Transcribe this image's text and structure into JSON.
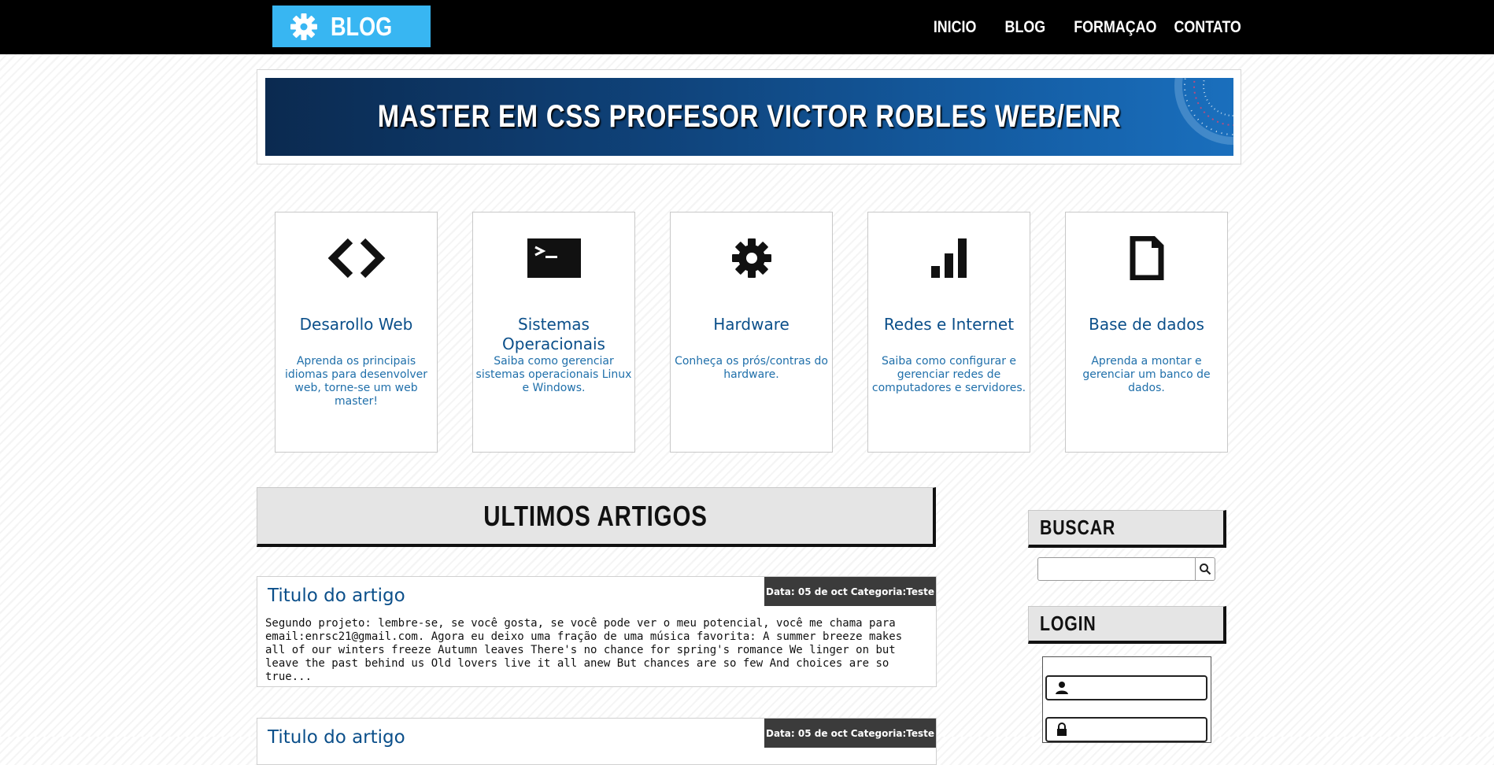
{
  "header": {
    "logo_text": "BLOG",
    "nav": [
      "INICIO",
      "BLOG",
      "FORMAÇAO",
      "CONTATO"
    ]
  },
  "banner": {
    "title": "MASTER EM CSS PROFESOR VICTOR ROBLES WEB/ENR"
  },
  "cards": [
    {
      "icon": "code-icon",
      "title": "Desarollo Web",
      "desc": "Aprenda os principais idiomas para desenvolver web, torne-se um web master!"
    },
    {
      "icon": "terminal-icon",
      "title": "Sistemas Operacionais",
      "desc": "Saiba como gerenciar sistemas operacionais Linux e Windows."
    },
    {
      "icon": "gear-icon",
      "title": "Hardware",
      "desc": "Conheça os prós/contras do hardware."
    },
    {
      "icon": "signal-bars-icon",
      "title": "Redes e Internet",
      "desc": "Saiba como configurar e gerenciar redes de computadores e servidores."
    },
    {
      "icon": "document-icon",
      "title": "Base de dados",
      "desc": "Aprenda a montar e gerenciar um banco de dados."
    }
  ],
  "articles_section": {
    "title": "ULTIMOS ARTIGOS"
  },
  "articles": [
    {
      "title": "Titulo do artigo",
      "date": "Data: 05 de oct",
      "category": "Categoria:Teste",
      "body": "Segundo projeto: lembre-se, se você gosta, se você pode ver o meu potencial, você me chama para email:enrsc21@gmail.com. Agora eu deixo uma fração de uma música favorita: A summer breeze makes all of our winters freeze Autumn leaves There's no chance for spring's romance We linger on but leave the past behind us Old lovers live it all anew But chances are so few And choices are so true..."
    },
    {
      "title": "Titulo do artigo",
      "date": "Data: 05 de oct",
      "category": "Categoria:Teste",
      "body": ""
    }
  ],
  "sidebar": {
    "search_title": "BUSCAR",
    "search_value": "",
    "login_title": "LOGIN",
    "user_value": "",
    "password_value": ""
  }
}
